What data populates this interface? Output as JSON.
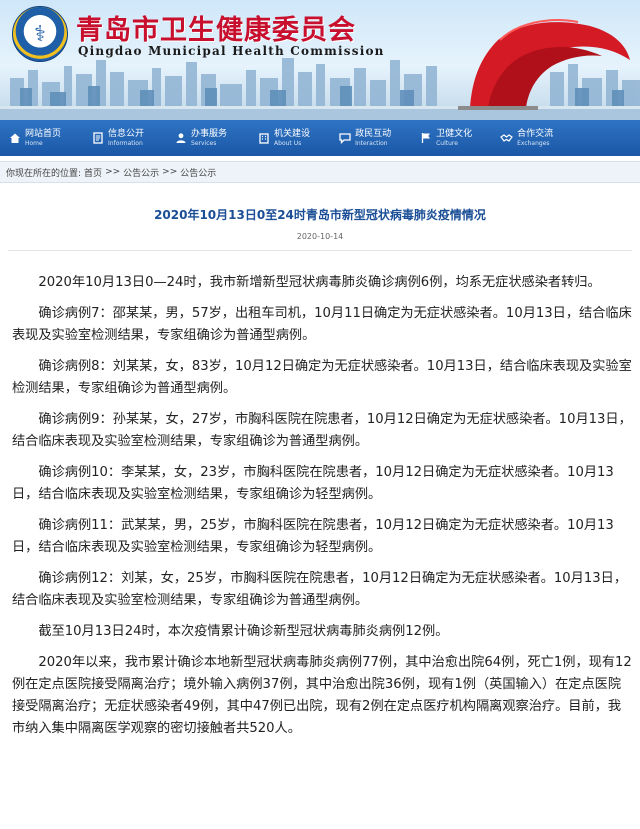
{
  "header": {
    "title": "青岛市卫生健康委员会",
    "subtitle": "Qingdao Municipal Health Commission"
  },
  "nav": {
    "items": [
      {
        "cn": "网站首页",
        "en": "Home",
        "icon": "home-icon"
      },
      {
        "cn": "信息公开",
        "en": "Information",
        "icon": "document-icon"
      },
      {
        "cn": "办事服务",
        "en": "Services",
        "icon": "person-icon"
      },
      {
        "cn": "机关建设",
        "en": "About Us",
        "icon": "building-icon"
      },
      {
        "cn": "政民互动",
        "en": "Interaction",
        "icon": "chat-icon"
      },
      {
        "cn": "卫健文化",
        "en": "Culture",
        "icon": "flag-icon"
      },
      {
        "cn": "合作交流",
        "en": "Exchanges",
        "icon": "handshake-icon"
      }
    ]
  },
  "breadcrumb": {
    "prefix": "你现在所在的位置:",
    "items": [
      "首页",
      "公告公示",
      "公告公示"
    ],
    "separator": ">>"
  },
  "article": {
    "title": "2020年10月13日0至24时青岛市新型冠状病毒肺炎疫情情况",
    "date": "2020-10-14",
    "paragraphs": [
      "2020年10月13日0—24时，我市新增新型冠状病毒肺炎确诊病例6例，均系无症状感染者转归。",
      "确诊病例7：邵某某，男，57岁，出租车司机，10月11日确定为无症状感染者。10月13日，结合临床表现及实验室检测结果，专家组确诊为普通型病例。",
      "确诊病例8：刘某某，女，83岁，10月12日确定为无症状感染者。10月13日，结合临床表现及实验室检测结果，专家组确诊为普通型病例。",
      "确诊病例9：孙某某，女，27岁，市胸科医院在院患者，10月12日确定为无症状感染者。10月13日，结合临床表现及实验室检测结果，专家组确诊为普通型病例。",
      "确诊病例10：李某某，女，23岁，市胸科医院在院患者，10月12日确定为无症状感染者。10月13日，结合临床表现及实验室检测结果，专家组确诊为轻型病例。",
      "确诊病例11：武某某，男，25岁，市胸科医院在院患者，10月12日确定为无症状感染者。10月13日，结合临床表现及实验室检测结果，专家组确诊为轻型病例。",
      "确诊病例12：刘某，女，25岁，市胸科医院在院患者，10月12日确定为无症状感染者。10月13日，结合临床表现及实验室检测结果，专家组确诊为普通型病例。",
      "截至10月13日24时，本次疫情累计确诊新型冠状病毒肺炎病例12例。",
      "2020年以来，我市累计确诊本地新型冠状病毒肺炎病例77例，其中治愈出院64例，死亡1例，现有12例在定点医院接受隔离治疗；境外输入病例37例，其中治愈出院36例，现有1例（英国输入）在定点医院接受隔离治疗；无症状感染者49例，其中47例已出院，现有2例在定点医疗机构隔离观察治疗。目前，我市纳入集中隔离医学观察的密切接触者共520人。"
    ]
  },
  "colors": {
    "nav_bg": "#1a57a6",
    "title_red": "#c8102e",
    "article_title": "#1a4e96",
    "sculpture_red": "#d41a24"
  }
}
